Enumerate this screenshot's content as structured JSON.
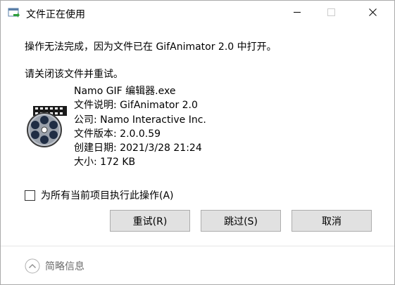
{
  "window": {
    "title": "文件正在使用",
    "title_icon": "file-transfer-icon",
    "controls": {
      "minimize_icon": "minimize-icon",
      "maximize_icon": "maximize-icon",
      "close_icon": "close-icon"
    }
  },
  "dialog": {
    "message": "操作无法完成，因为文件已在 GifAnimator 2.0 中打开。",
    "prompt": "请关闭该文件并重试。",
    "file": {
      "icon": "film-reel-icon",
      "name": "Namo GIF 编辑器.exe",
      "description": "文件说明: GifAnimator 2.0",
      "company": "公司: Namo Interactive Inc.",
      "version": "文件版本: 2.0.0.59",
      "created": "创建日期: 2021/3/28 21:24",
      "size": "大小: 172 KB"
    },
    "apply_all": {
      "label": "为所有当前项目执行此操作(A)",
      "checked": false
    },
    "buttons": {
      "retry": "重试(R)",
      "skip": "跳过(S)",
      "cancel": "取消"
    },
    "details": {
      "label": "简略信息",
      "icon": "chevron-up-circle-icon"
    }
  },
  "colors": {
    "button_bg": "#e1e1e1",
    "button_border": "#adadad",
    "details_text": "#6d6d6d"
  }
}
